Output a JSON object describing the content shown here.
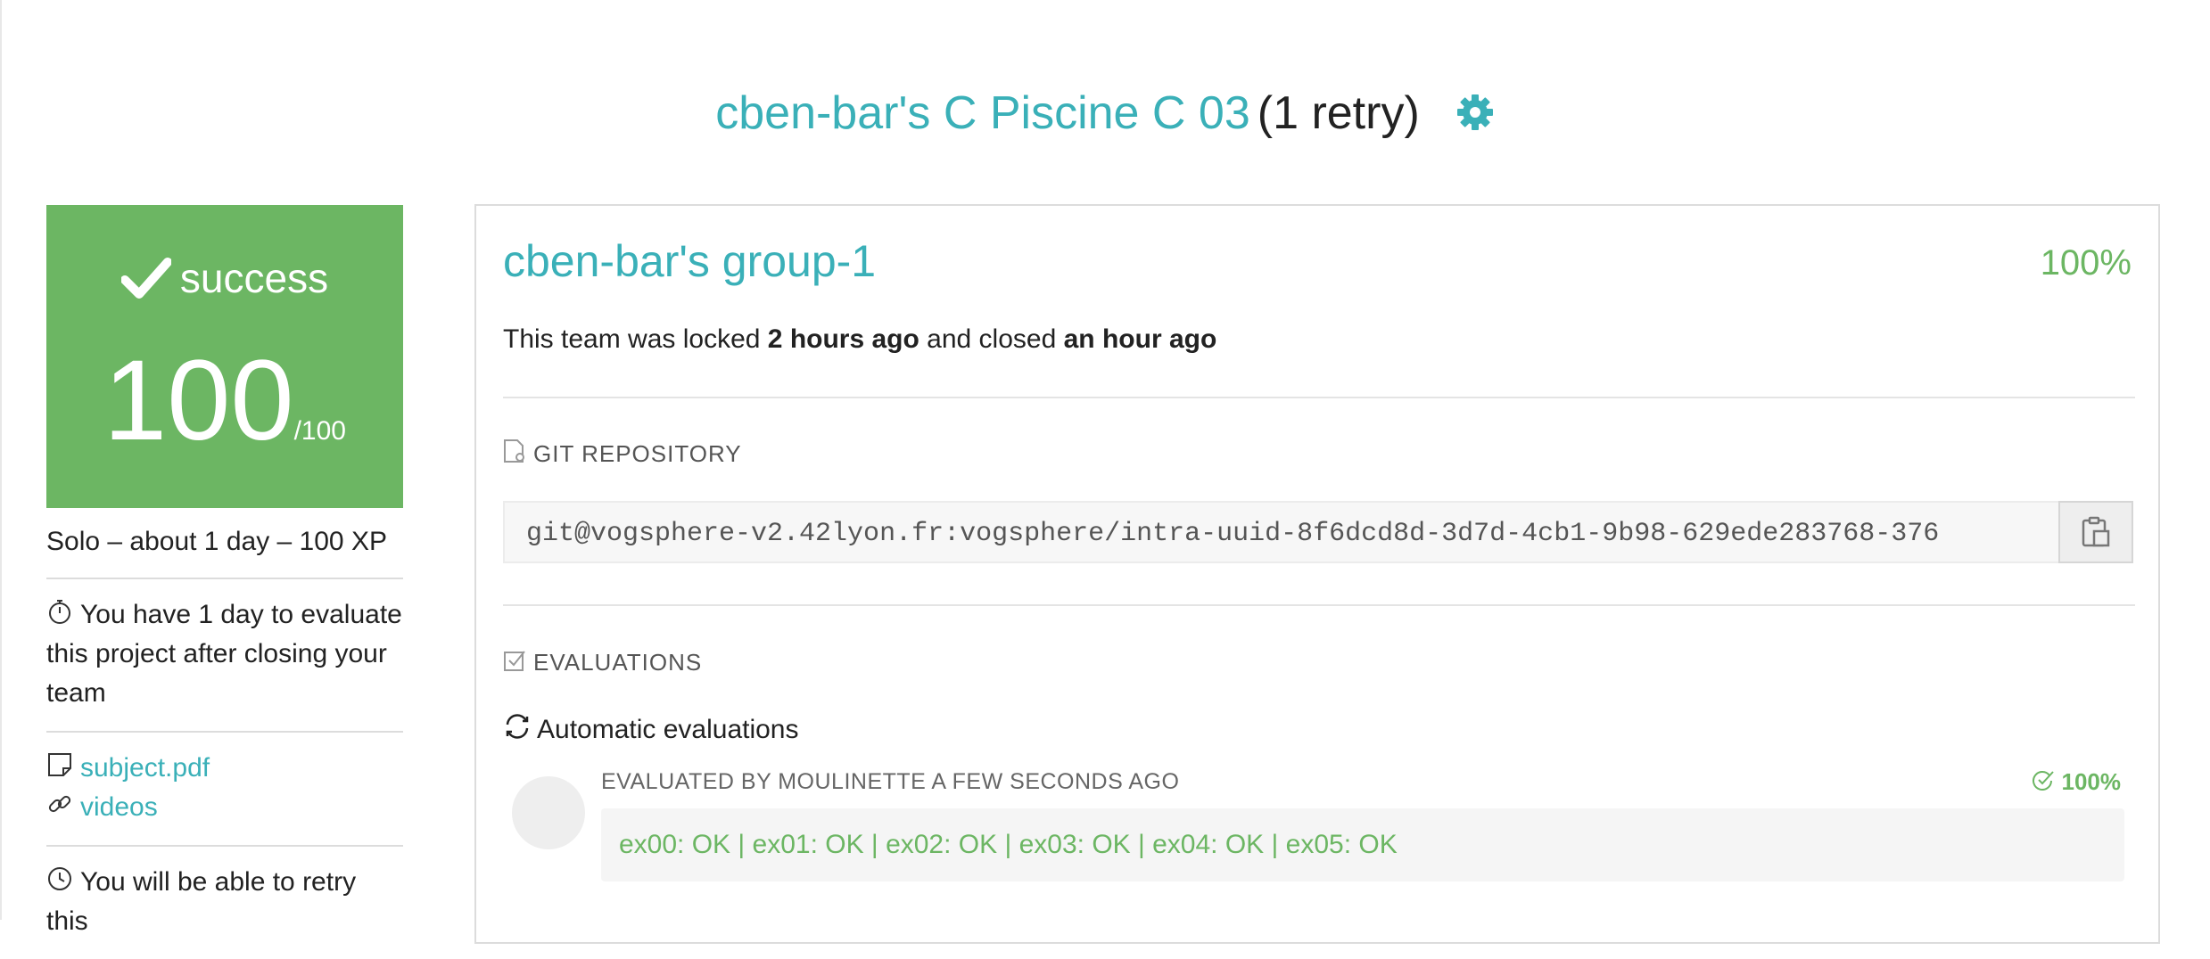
{
  "header": {
    "project_title": "cben-bar's C Piscine C 03",
    "retry_text": "(1 retry)",
    "settings_icon": "gear-icon"
  },
  "status_card": {
    "status_icon": "checkmark-icon",
    "status_label": "success",
    "grade": "100",
    "grade_max": "/100"
  },
  "sidebar": {
    "summary": "Solo – about 1 day – 100 XP",
    "evaluation_notice": "You have 1 day to evaluate this project after closing your team",
    "links": [
      {
        "label": "subject.pdf",
        "icon": "document-icon"
      },
      {
        "label": "videos",
        "icon": "link-icon"
      }
    ],
    "retry_notice": "You will be able to retry this"
  },
  "team": {
    "name": "cben-bar's group-1",
    "percentage": "100%",
    "locked_prefix": "This team was locked",
    "locked_time": "2 hours ago",
    "closed_prefix": "and closed",
    "closed_time": "an hour ago"
  },
  "git": {
    "section_title": "GIT REPOSITORY",
    "repo_url": "git@vogsphere-v2.42lyon.fr:vogsphere/intra-uuid-8f6dcd8d-3d7d-4cb1-9b98-629ede283768-376"
  },
  "evaluations": {
    "section_title": "EVALUATIONS",
    "automatic_label": "Automatic evaluations",
    "evaluated_by": "EVALUATED BY MOULINETTE A FEW SECONDS AGO",
    "score": "100%",
    "result": "ex00: OK | ex01: OK | ex02: OK | ex03: OK | ex04: OK | ex05: OK"
  },
  "colors": {
    "accent": "#3ab0b8",
    "success": "#6cb663"
  }
}
